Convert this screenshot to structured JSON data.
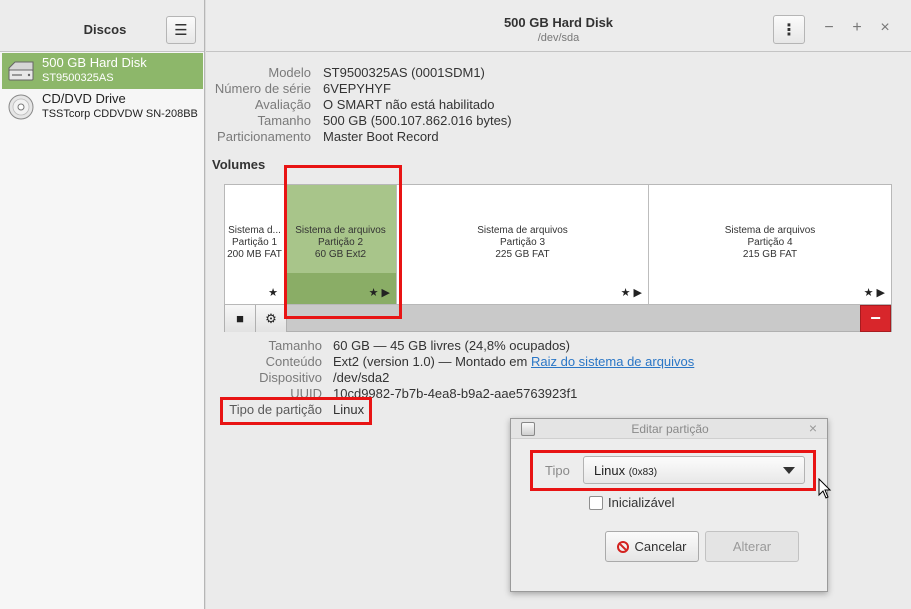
{
  "sidebar": {
    "title": "Discos",
    "menu_icon": "hamburger-icon",
    "disks": [
      {
        "name": "500 GB Hard Disk",
        "model": "ST9500325AS",
        "icon": "hard-disk-icon",
        "selected": true
      },
      {
        "name": "CD/DVD Drive",
        "model": "TSSTcorp CDDVDW SN-208BB",
        "icon": "optical-disc-icon",
        "selected": false
      }
    ]
  },
  "header": {
    "title": "500 GB Hard Disk",
    "subtitle": "/dev/sda",
    "menu_icon": "kebab-menu-icon",
    "minimize": "−",
    "maximize": "+",
    "close": "×"
  },
  "disk_info": [
    {
      "label": "Modelo",
      "value": "ST9500325AS (0001SDM1)"
    },
    {
      "label": "Número de série",
      "value": "6VEPYHYF"
    },
    {
      "label": "Avaliação",
      "value": "O SMART não está habilitado"
    },
    {
      "label": "Tamanho",
      "value": "500 GB (500.107.862.016 bytes)"
    },
    {
      "label": "Particionamento",
      "value": "Master Boot Record"
    }
  ],
  "volumes": {
    "title": "Volumes",
    "partitions": [
      {
        "line1": "Sistema d...",
        "line2": "Partição 1",
        "line3": "200 MB FAT",
        "icons": "★",
        "selected": false
      },
      {
        "line1": "Sistema de arquivos",
        "line2": "Partição 2",
        "line3": "60 GB Ext2",
        "icons": "★ ▶",
        "selected": true
      },
      {
        "line1": "Sistema de arquivos",
        "line2": "Partição 3",
        "line3": "225 GB FAT",
        "icons": "★ ▶",
        "selected": false
      },
      {
        "line1": "Sistema de arquivos",
        "line2": "Partição 4",
        "line3": "215 GB FAT",
        "icons": "★ ▶",
        "selected": false
      }
    ],
    "toolbar": {
      "stop_icon": "stop-icon",
      "settings_icon": "gears-icon",
      "delete_icon": "minus-icon",
      "stop_glyph": "■",
      "settings_glyph": "⚙",
      "delete_glyph": "−"
    }
  },
  "partition_info": [
    {
      "label": "Tamanho",
      "value": "60 GB — 45 GB livres (24,8% ocupados)"
    },
    {
      "label": "Conteúdo",
      "value": "Ext2 (version 1.0) — Montado em ",
      "link": "Raiz do sistema de arquivos"
    },
    {
      "label": "Dispositivo",
      "value": "/dev/sda2"
    },
    {
      "label": "UUID",
      "value": "10cd9982-7b7b-4ea8-b9a2-aae5763923f1"
    },
    {
      "label": "Tipo de partição",
      "value": "Linux"
    }
  ],
  "dialog": {
    "title": "Editar partição",
    "close": "×",
    "type_label": "Tipo",
    "type_value": "Linux",
    "type_code": "(0x83)",
    "bootable_label": "Inicializável",
    "bootable_checked": false,
    "cancel_label": "Cancelar",
    "apply_label": "Alterar",
    "apply_enabled": false
  },
  "colors": {
    "selection_green": "#8db76a",
    "partition_selected": "#a8c58a",
    "annotation_red": "#e81414",
    "delete_red": "#d8262b",
    "link_blue": "#2a76c6"
  }
}
